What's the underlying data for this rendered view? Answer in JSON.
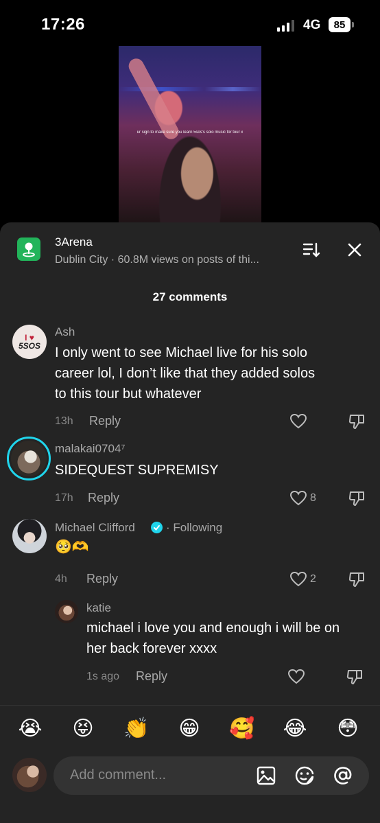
{
  "status_bar": {
    "time": "17:26",
    "network": "4G",
    "battery": "85"
  },
  "video": {
    "caption": "ur sign to make sure you learn 5sos's solo music for tour x"
  },
  "location": {
    "title": "3Arena",
    "subtitle": "Dublin City · 60.8M views on posts of thi..."
  },
  "comments_header": {
    "count_label": "27 comments"
  },
  "comments": [
    {
      "username": "Ash",
      "text_lines": [
        "I only went to see Michael live for his solo",
        "career lol, I don’t like that they added solos",
        "to this tour but whatever"
      ],
      "time": "13h",
      "reply_label": "Reply",
      "likes": "",
      "avatar_text": "I ❤ 5SOS"
    },
    {
      "username": "malakai0704⁷",
      "text_lines": [
        "SIDEQUEST SUPREMISY"
      ],
      "time": "17h",
      "reply_label": "Reply",
      "likes": "8"
    },
    {
      "username": "Michael Clifford",
      "verified": true,
      "following_label": "· Following",
      "text_lines": [
        "🥺🫶"
      ],
      "time": "4h",
      "reply_label": "Reply",
      "likes": "2"
    },
    {
      "username": "katie",
      "text_lines": [
        "michael i love you and enough i will be on",
        "her back forever xxxx"
      ],
      "time": "1s ago",
      "reply_label": "Reply",
      "likes": ""
    }
  ],
  "emoji_bar": [
    "😭",
    "😝",
    "👏",
    "😁",
    "🥰",
    "😂",
    "😳"
  ],
  "composer": {
    "placeholder": "Add comment..."
  },
  "colors": {
    "sheet_bg": "#242424",
    "location_icon": "#22b45a",
    "verified": "#20d5ec"
  },
  "icons": [
    "location-pin-icon",
    "sort-icon",
    "close-icon",
    "heart-icon",
    "dislike-icon",
    "verified-icon",
    "image-icon",
    "sticker-icon",
    "mention-icon"
  ]
}
